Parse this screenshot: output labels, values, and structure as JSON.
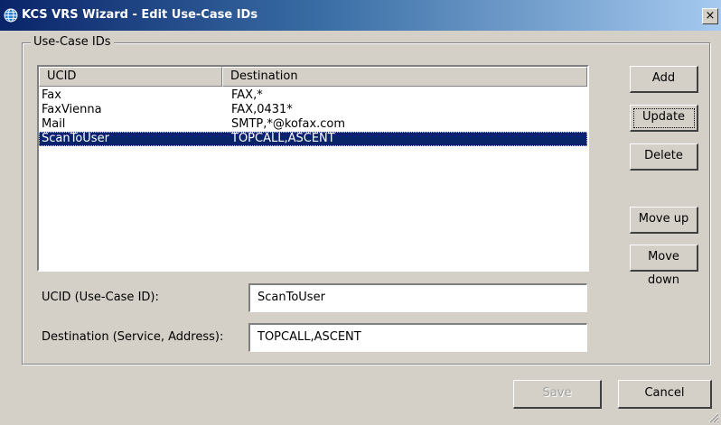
{
  "window": {
    "title": "KCS VRS Wizard - Edit Use-Case IDs",
    "close_glyph": "×"
  },
  "group": {
    "label": "Use-Case IDs"
  },
  "list": {
    "columns": [
      "UCID",
      "Destination"
    ],
    "rows": [
      {
        "ucid": "Fax",
        "destination": "FAX,*"
      },
      {
        "ucid": "FaxVienna",
        "destination": "FAX,0431*"
      },
      {
        "ucid": "Mail",
        "destination": "SMTP,*@kofax.com"
      },
      {
        "ucid": "ScanToUser",
        "destination": "TOPCALL,ASCENT"
      }
    ],
    "selected_index": 3
  },
  "buttons": {
    "add": "Add",
    "update": "Update",
    "delete": "Delete",
    "move_up": "Move up",
    "move_down": "Move down",
    "save": "Save",
    "cancel": "Cancel"
  },
  "form": {
    "ucid_label": "UCID (Use-Case ID):",
    "ucid_value": "ScanToUser",
    "destination_label": "Destination (Service, Address):",
    "destination_value": "TOPCALL,ASCENT"
  },
  "colors": {
    "selection": "#0a246a",
    "titlebar_start": "#0a246a",
    "face": "#d4d0c8"
  }
}
